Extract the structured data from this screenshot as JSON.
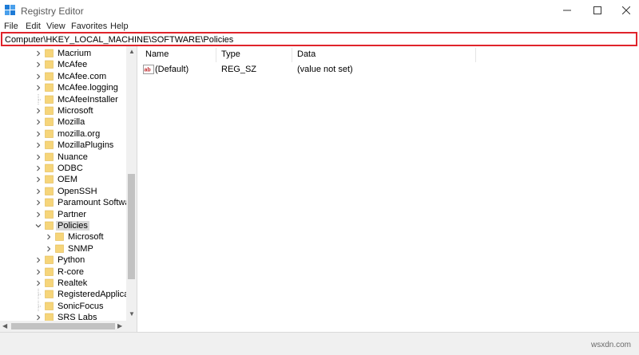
{
  "window": {
    "title": "Registry Editor"
  },
  "menu": [
    "File",
    "Edit",
    "View",
    "Favorites",
    "Help"
  ],
  "address": {
    "path": "Computer\\HKEY_LOCAL_MACHINE\\SOFTWARE\\Policies"
  },
  "tree": {
    "items": [
      {
        "label": "Macrium",
        "depth": 0,
        "expander": "collapsed"
      },
      {
        "label": "McAfee",
        "depth": 0,
        "expander": "collapsed"
      },
      {
        "label": "McAfee.com",
        "depth": 0,
        "expander": "collapsed"
      },
      {
        "label": "McAfee.logging",
        "depth": 0,
        "expander": "collapsed"
      },
      {
        "label": "McAfeeInstaller",
        "depth": 0,
        "expander": "none"
      },
      {
        "label": "Microsoft",
        "depth": 0,
        "expander": "collapsed"
      },
      {
        "label": "Mozilla",
        "depth": 0,
        "expander": "collapsed"
      },
      {
        "label": "mozilla.org",
        "depth": 0,
        "expander": "collapsed"
      },
      {
        "label": "MozillaPlugins",
        "depth": 0,
        "expander": "collapsed"
      },
      {
        "label": "Nuance",
        "depth": 0,
        "expander": "collapsed"
      },
      {
        "label": "ODBC",
        "depth": 0,
        "expander": "collapsed"
      },
      {
        "label": "OEM",
        "depth": 0,
        "expander": "collapsed"
      },
      {
        "label": "OpenSSH",
        "depth": 0,
        "expander": "collapsed"
      },
      {
        "label": "Paramount Software",
        "depth": 0,
        "expander": "collapsed"
      },
      {
        "label": "Partner",
        "depth": 0,
        "expander": "collapsed"
      },
      {
        "label": "Policies",
        "depth": 0,
        "expander": "expanded",
        "selected": true
      },
      {
        "label": "Microsoft",
        "depth": 1,
        "expander": "collapsed"
      },
      {
        "label": "SNMP",
        "depth": 1,
        "expander": "collapsed"
      },
      {
        "label": "Python",
        "depth": 0,
        "expander": "collapsed"
      },
      {
        "label": "R-core",
        "depth": 0,
        "expander": "collapsed"
      },
      {
        "label": "Realtek",
        "depth": 0,
        "expander": "collapsed"
      },
      {
        "label": "RegisteredApplicati",
        "depth": 0,
        "expander": "none"
      },
      {
        "label": "SonicFocus",
        "depth": 0,
        "expander": "none"
      },
      {
        "label": "SRS Labs",
        "depth": 0,
        "expander": "collapsed"
      }
    ]
  },
  "list": {
    "columns": [
      "Name",
      "Type",
      "Data"
    ],
    "rows": [
      {
        "name": "(Default)",
        "type": "REG_SZ",
        "data": "(value not set)",
        "icon": "string-value-icon"
      }
    ]
  },
  "watermark": "wsxdn.com",
  "colors": {
    "highlight": "#e0242b",
    "folder": "#f6d57a",
    "selection": "#d9d9d9"
  }
}
